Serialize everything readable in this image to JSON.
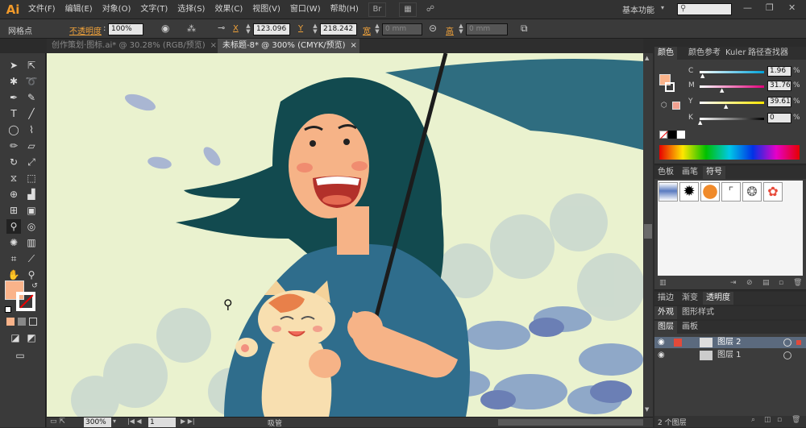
{
  "app": {
    "logo": "Ai"
  },
  "menu": [
    "文件(F)",
    "编辑(E)",
    "对象(O)",
    "文字(T)",
    "选择(S)",
    "效果(C)",
    "视图(V)",
    "窗口(W)",
    "帮助(H)"
  ],
  "workspace": "基本功能",
  "window_controls": [
    "minimize-icon",
    "restore-icon",
    "close-icon"
  ],
  "control_bar": {
    "selection_label": "网格点",
    "opacity_label": "不透明度",
    "opacity_value": "100%",
    "x_label": "X",
    "x_value": "123.096",
    "y_label": "Y",
    "y_value": "218.242",
    "width_label": "宽",
    "width_value": "0 mm",
    "height_label": "高",
    "height_value": "0 mm"
  },
  "doc_tabs": [
    {
      "label": "创作策划·图标.ai* @ 30.28% (RGB/预览)",
      "active": false
    },
    {
      "label": "未标题-8* @ 300% (CMYK/预览)",
      "active": true
    }
  ],
  "status": {
    "zoom": "300%",
    "page": "1",
    "tool_name": "吸管"
  },
  "color_panel": {
    "tabs": [
      "颜色",
      "颜色参考",
      "Kuler",
      "路径查找器"
    ],
    "channels": [
      {
        "label": "C",
        "value": "1.96",
        "gradient": [
          "#ffffff",
          "#00a3d9"
        ]
      },
      {
        "label": "M",
        "value": "31.76",
        "gradient": [
          "#ffffff",
          "#e2007a"
        ]
      },
      {
        "label": "Y",
        "value": "39.61",
        "gradient": [
          "#ffffff",
          "#ffe600"
        ]
      },
      {
        "label": "K",
        "value": "0",
        "gradient": [
          "#ffffff",
          "#000000"
        ]
      }
    ],
    "percent": "%",
    "fill_color": "#fab38a"
  },
  "swatch_panel": {
    "tabs": [
      "色板",
      "画笔",
      "符号"
    ]
  },
  "stroke_panel": {
    "tabs": [
      "描边",
      "渐变",
      "透明度"
    ]
  },
  "appearance_panel": {
    "tabs": [
      "外观",
      "图形样式"
    ]
  },
  "layers_panel": {
    "tabs": [
      "图层",
      "画板"
    ],
    "layers": [
      {
        "name": "图层 2",
        "active": true
      },
      {
        "name": "图层 1",
        "active": false
      }
    ],
    "footer": "2 个图层"
  }
}
